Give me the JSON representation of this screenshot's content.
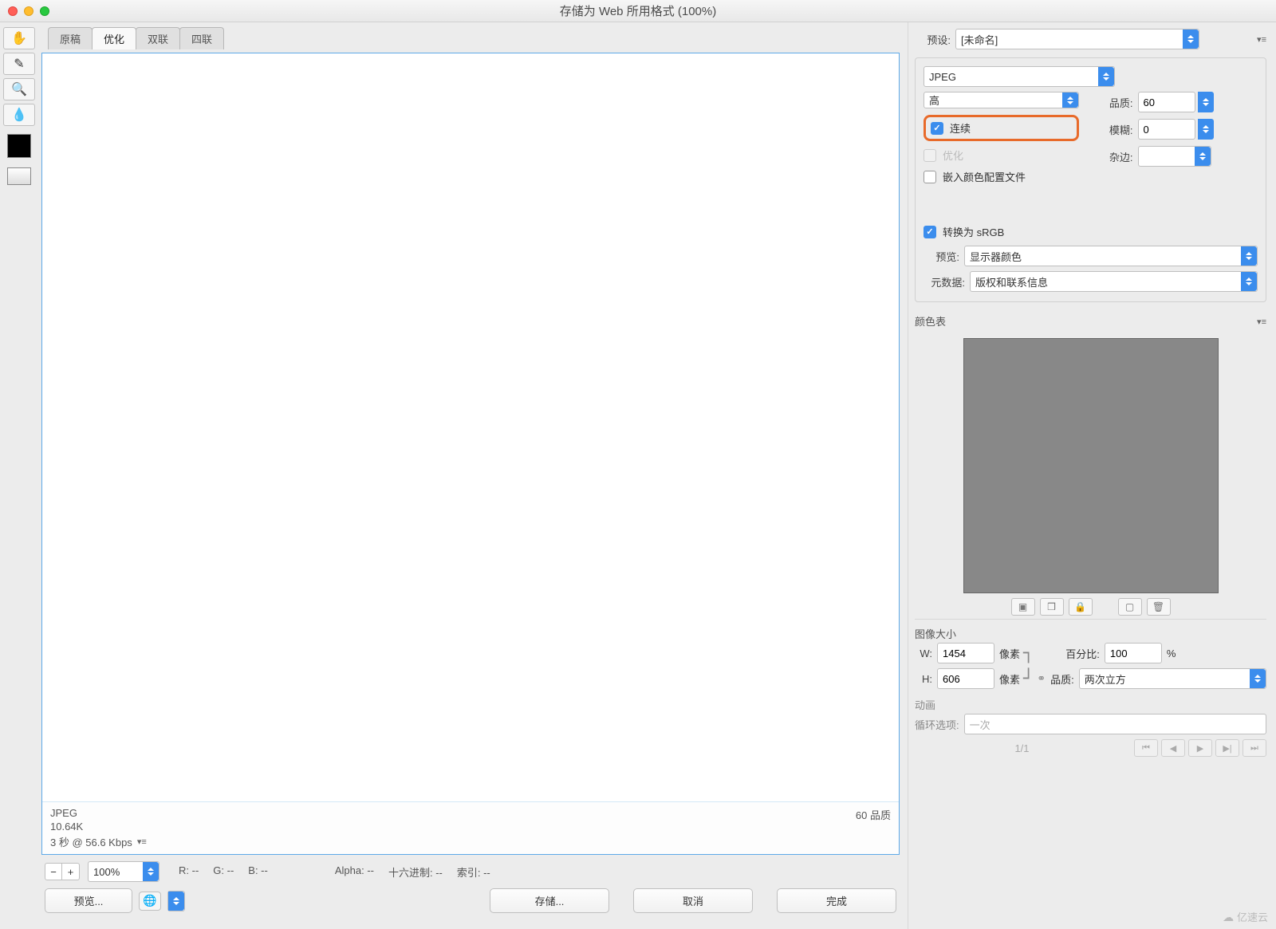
{
  "window": {
    "title": "存储为 Web 所用格式 (100%)"
  },
  "tabs": [
    "原稿",
    "优化",
    "双联",
    "四联"
  ],
  "active_tab": "优化",
  "preview_info": {
    "format": "JPEG",
    "size": "10.64K",
    "timing": "3 秒 @ 56.6 Kbps",
    "quality_label": "60 品质"
  },
  "zoom": {
    "value": "100%"
  },
  "readout": {
    "R": "R: --",
    "G": "G: --",
    "B": "B: --",
    "Alpha": "Alpha: --",
    "Hex": "十六进制: --",
    "Index": "索引: --"
  },
  "buttons": {
    "preview": "预览...",
    "save": "存储...",
    "cancel": "取消",
    "done": "完成"
  },
  "right": {
    "preset_label": "预设:",
    "preset_value": "[未命名]",
    "format": "JPEG",
    "quality_preset": "高",
    "quality_label": "品质:",
    "quality_value": "60",
    "progressive": "连续",
    "optimized": "优化",
    "embed_profile": "嵌入颜色配置文件",
    "blur_label": "模糊:",
    "blur_value": "0",
    "matte_label": "杂边:",
    "matte_value": "",
    "convert_srgb": "转换为 sRGB",
    "preview_label": "预览:",
    "preview_value": "显示器颜色",
    "metadata_label": "元数据:",
    "metadata_value": "版权和联系信息",
    "color_table_label": "颜色表",
    "image_size_label": "图像大小",
    "W_label": "W:",
    "W_value": "1454",
    "H_label": "H:",
    "H_value": "606",
    "px": "像素",
    "percent_label": "百分比:",
    "percent_value": "100",
    "percent_unit": "%",
    "quality2_label": "品质:",
    "quality2_value": "两次立方",
    "anim_label": "动画",
    "loop_label": "循环选项:",
    "loop_value": "一次",
    "frame": "1/1"
  },
  "watermark": "亿速云"
}
